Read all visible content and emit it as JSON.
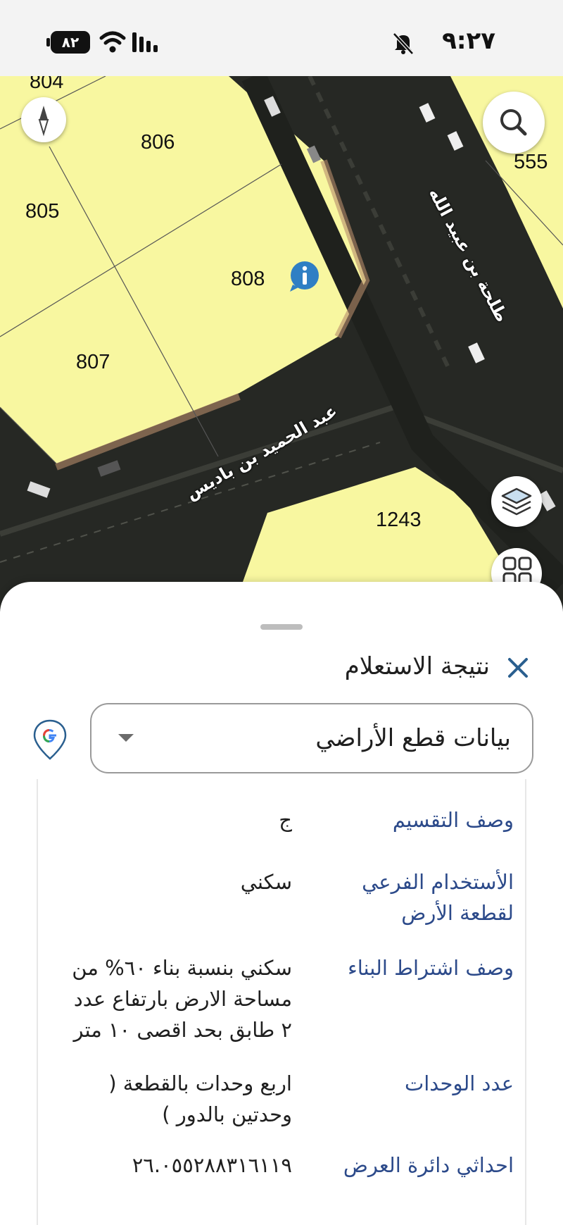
{
  "status_bar": {
    "time": "٩:٢٧",
    "battery": "٨٢"
  },
  "map": {
    "plots": [
      "804",
      "806",
      "805",
      "808",
      "807",
      "555",
      "1243"
    ],
    "streets": [
      "طلحة بن عبيد الله",
      "عبد الحميد بن باديس"
    ]
  },
  "sheet": {
    "title": "نتيجة الاستعلام",
    "select_value": "بيانات قطع الأراضي",
    "rows": [
      {
        "label": "وصف التقسيم",
        "value": "ج"
      },
      {
        "label": "الأستخدام الفرعي لقطعة الأرض",
        "value": "سكني"
      },
      {
        "label": "وصف اشتراط البناء",
        "value": "سكني بنسبة بناء ٦٠% من مساحة الارض بارتفاع عدد ٢ طابق بحد اقصى ١٠ متر"
      },
      {
        "label": "عدد الوحدات",
        "value": "اربع وحدات بالقطعة ( وحدتين بالدور )"
      },
      {
        "label": "احداثي دائرة العرض",
        "value": "٢٦.٠٥٥٢٨٨٣١٦١١٩"
      }
    ]
  }
}
